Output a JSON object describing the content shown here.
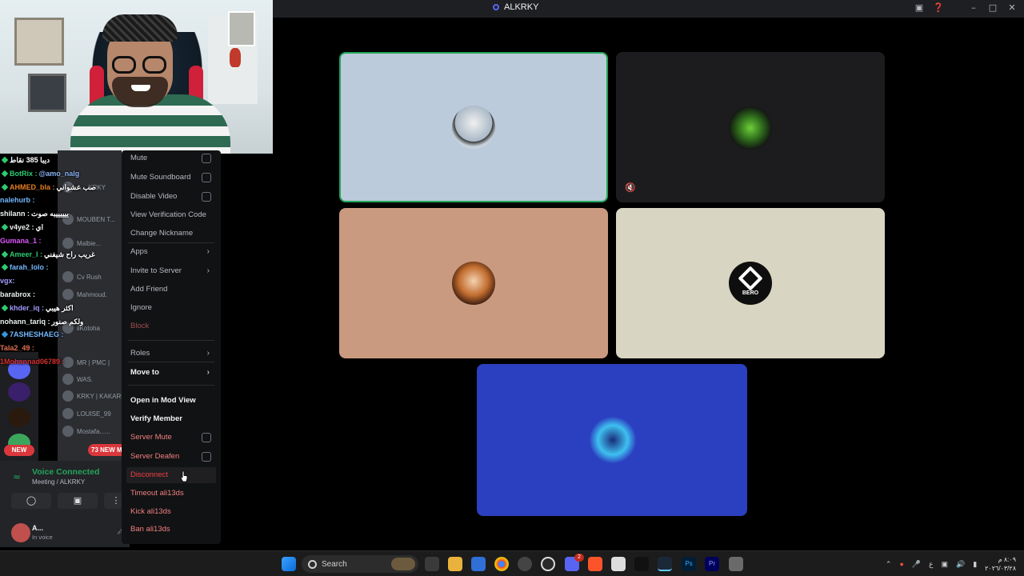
{
  "window": {
    "title": "ALKRKY"
  },
  "chat": {
    "rows": [
      {
        "name": "",
        "msg": "ديبا 385 نقاط",
        "color": "#ffffff"
      },
      {
        "name": "BotRix :",
        "msg": "@amo_nalg",
        "color": "#2ecc71"
      },
      {
        "name": "AHMED_bla :",
        "msg": "صب عشواني",
        "color": "#e67e22"
      },
      {
        "name": "nalehurb :",
        "msg": "",
        "color": "#3498db"
      },
      {
        "name": "shilann :",
        "msg": "ييييييبه صوت",
        "color": "#ecf0f1"
      },
      {
        "name": "v4ye2 :",
        "msg": "اي",
        "color": "#ecf0f1"
      },
      {
        "name": "Gumana_1 :",
        "msg": "",
        "color": "#e056fd"
      },
      {
        "name": "Ameer_I :",
        "msg": "غريب راح شيفني",
        "color": "#2ecc71"
      },
      {
        "name": "farah_lolo :",
        "msg": "",
        "color": "#74b9ff"
      },
      {
        "name": "vgx:",
        "msg": "",
        "color": "#a29bfe"
      },
      {
        "name": "barabrox :",
        "msg": "",
        "color": "#ecf0f1"
      },
      {
        "name": "khder_iq :",
        "msg": "اكثر هيبي",
        "color": "#a29bfe"
      },
      {
        "name": "nohann_tariq :",
        "msg": "ولكم صنور",
        "color": "#ecf0f1"
      },
      {
        "name": "7ASHESHAEG :",
        "msg": "",
        "color": "#74b9ff"
      },
      {
        "name": "Tala2_49 :",
        "msg": "",
        "color": "#e17055"
      },
      {
        "name": "1Mohannad06789 :",
        "msg": "",
        "color": "#d63031"
      }
    ]
  },
  "members": {
    "rows": [
      "A...  KRKY",
      "MOUBEN T...",
      "Malbie...",
      "Cv Rush",
      "Mahmoud.",
      "iiKotoha",
      "MR | PMC |",
      "WAS.",
      "KRKY | KAKARO",
      "LOUISE_99",
      "Mostafa......"
    ]
  },
  "badges": {
    "new": "NEW",
    "new_mentions": "73 NEW MI"
  },
  "voice_panel": {
    "title": "Voice Connected",
    "channel": "Meeting / ALKRKY",
    "user_name": "A...",
    "user_status": "In voice"
  },
  "context_menu": {
    "items": [
      {
        "label": "Mute",
        "style": "normal",
        "checkbox": true
      },
      {
        "label": "Mute Soundboard",
        "style": "normal",
        "checkbox": true
      },
      {
        "label": "Disable Video",
        "style": "normal",
        "checkbox": true
      },
      {
        "label": "View Verification Code",
        "style": "normal"
      },
      {
        "label": "Change Nickname",
        "style": "normal"
      },
      {
        "label": "Apps",
        "style": "normal",
        "submenu": true
      },
      {
        "label": "Invite to Server",
        "style": "normal",
        "submenu": true
      },
      {
        "label": "Add Friend",
        "style": "normal"
      },
      {
        "label": "Ignore",
        "style": "normal"
      },
      {
        "label": "Block",
        "style": "block"
      },
      {
        "label": "Roles",
        "style": "normal",
        "submenu": true
      },
      {
        "label": "Move to",
        "style": "white",
        "submenu": true
      },
      {
        "label": "Open in Mod View",
        "style": "white"
      },
      {
        "label": "Verify Member",
        "style": "white"
      },
      {
        "label": "Server Mute",
        "style": "redsoft",
        "checkbox": true
      },
      {
        "label": "Server Deafen",
        "style": "redsoft",
        "checkbox": true
      },
      {
        "label": "Disconnect",
        "style": "red"
      },
      {
        "label": "Timeout ali13ds",
        "style": "redsoft"
      },
      {
        "label": "Kick ali13ds",
        "style": "redsoft"
      },
      {
        "label": "Ban ali13ds",
        "style": "redsoft"
      }
    ]
  },
  "tiles": {
    "tile4_label": "BERO"
  },
  "taskbar": {
    "search_label": "Search",
    "clock_time": "٨:٠٩ م",
    "clock_date": "٢٠٢٦/٠٣/٢٨",
    "discord_badge": "2"
  },
  "colors": {
    "accent_green": "#23a55a",
    "danger_red": "#f23f42",
    "discord_blurple": "#5865f2"
  }
}
